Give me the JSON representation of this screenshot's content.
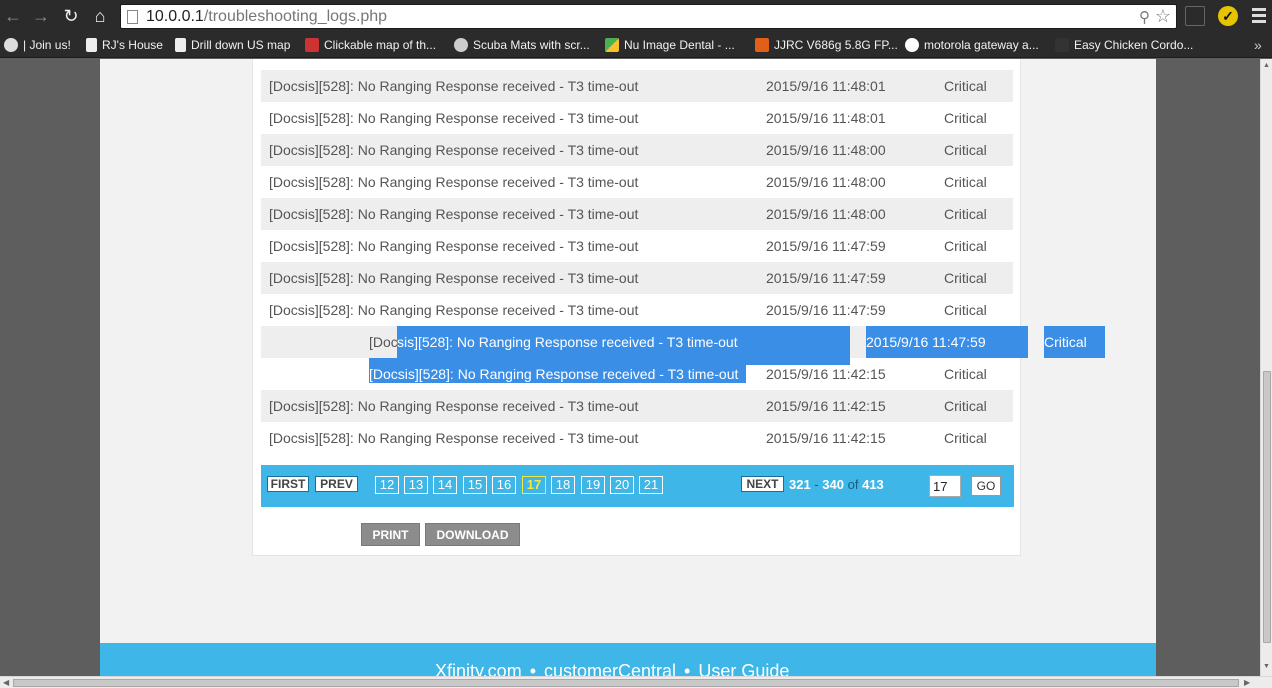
{
  "browser": {
    "url_host": "10.0.0.1",
    "url_path": "/troubleshooting_logs.php",
    "bookmarks": [
      {
        "label": "| Join us!"
      },
      {
        "label": "RJ's House"
      },
      {
        "label": "Drill down US map"
      },
      {
        "label": "Clickable map of th..."
      },
      {
        "label": "Scuba Mats with scr..."
      },
      {
        "label": "Nu Image Dental - ..."
      },
      {
        "label": "JJRC V686g 5.8G FP..."
      },
      {
        "label": "motorola gateway a..."
      },
      {
        "label": "Easy Chicken Cordo..."
      }
    ]
  },
  "logs": {
    "rows": [
      {
        "message": "[Docsis][528]: No Ranging Response received - T3 time-out",
        "time": "2015/9/16 11:48:01",
        "level": "Critical"
      },
      {
        "message": "[Docsis][528]: No Ranging Response received - T3 time-out",
        "time": "2015/9/16 11:48:01",
        "level": "Critical"
      },
      {
        "message": "[Docsis][528]: No Ranging Response received - T3 time-out",
        "time": "2015/9/16 11:48:00",
        "level": "Critical"
      },
      {
        "message": "[Docsis][528]: No Ranging Response received - T3 time-out",
        "time": "2015/9/16 11:48:00",
        "level": "Critical"
      },
      {
        "message": "[Docsis][528]: No Ranging Response received - T3 time-out",
        "time": "2015/9/16 11:48:00",
        "level": "Critical"
      },
      {
        "message": "[Docsis][528]: No Ranging Response received - T3 time-out",
        "time": "2015/9/16 11:47:59",
        "level": "Critical"
      },
      {
        "message": "[Docsis][528]: No Ranging Response received - T3 time-out",
        "time": "2015/9/16 11:47:59",
        "level": "Critical"
      },
      {
        "message": "[Docsis][528]: No Ranging Response received - T3 time-out",
        "time": "2015/9/16 11:47:59",
        "level": "Critical"
      },
      {
        "message": "[Docsis][528]: No Ranging Response received - T3 time-out",
        "time": "2015/9/16 11:47:59",
        "level": "Critical"
      },
      {
        "message": "[Docsis][528]: No Ranging Response received - T3 time-out",
        "time": "2015/9/16 11:42:15",
        "level": "Critical"
      },
      {
        "message": "[Docsis][528]: No Ranging Response received - T3 time-out",
        "time": "2015/9/16 11:42:15",
        "level": "Critical"
      },
      {
        "message": "[Docsis][528]: No Ranging Response received - T3 time-out",
        "time": "2015/9/16 11:42:15",
        "level": "Critical"
      }
    ],
    "selection": {
      "row9_prefix": "[Doc",
      "row9_selected": "sis][528]: No Ranging Response received - T3 time-out",
      "row10_selected": "[Docsis][528]: No Ranging Response received - T3 time-out"
    }
  },
  "pager": {
    "first": "FIRST",
    "prev": "PREV",
    "pages": [
      "12",
      "13",
      "14",
      "15",
      "16",
      "17",
      "18",
      "19",
      "20",
      "21"
    ],
    "current_page": "17",
    "next": "NEXT",
    "range_start": "321",
    "range_dash": "-",
    "range_end": "340",
    "range_of": "of",
    "total": "413",
    "page_input_value": "17",
    "go": "GO"
  },
  "actions": {
    "print": "PRINT",
    "download": "DOWNLOAD"
  },
  "footer": {
    "link1": "Xfinity.com",
    "sep": "•",
    "link2": "customerCentral",
    "link3": "User Guide"
  },
  "colors": {
    "accent": "#3fb6e8",
    "selection": "#3a8ee6",
    "current_page": "#f5e642"
  }
}
